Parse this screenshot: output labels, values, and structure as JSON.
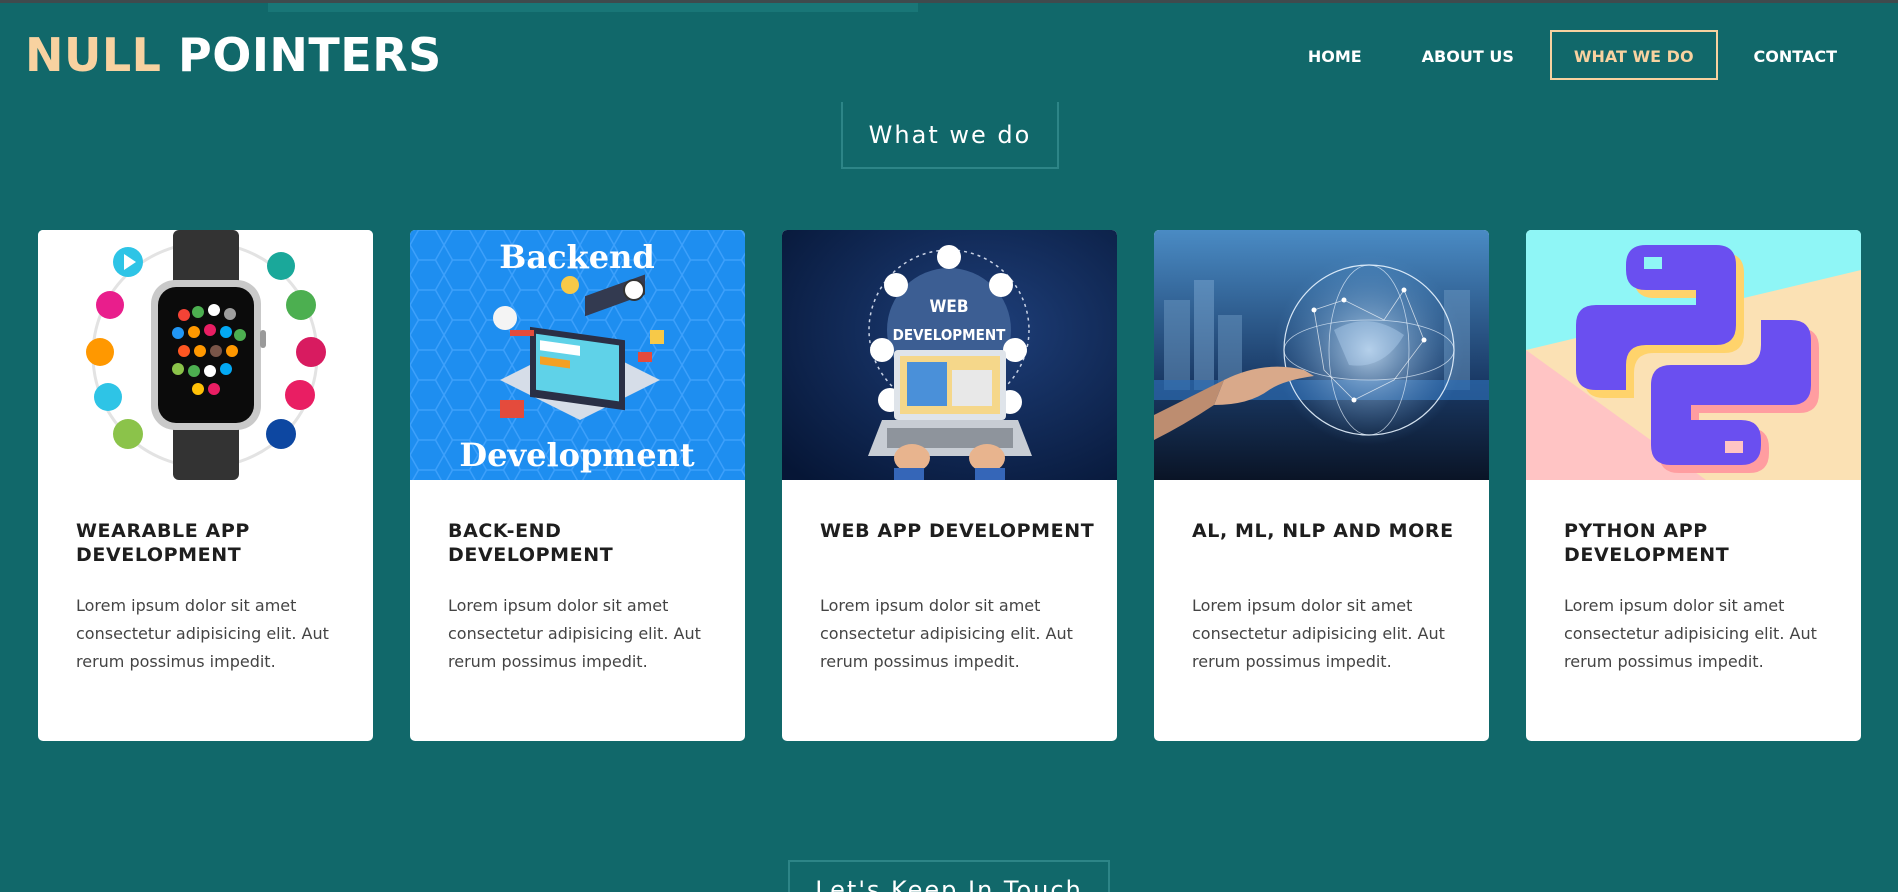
{
  "header": {
    "logo_accent": "NULL",
    "logo_main": "POINTERS",
    "nav": [
      {
        "label": "HOME"
      },
      {
        "label": "ABOUT US"
      },
      {
        "label": "WHAT WE DO"
      },
      {
        "label": "CONTACT"
      }
    ]
  },
  "section": {
    "title": "What we do"
  },
  "cards": [
    {
      "title": "WEARABLE APP DEVELOPMENT",
      "text": "Lorem ipsum dolor sit amet consectetur adipisicing elit. Aut rerum possimus impedit."
    },
    {
      "title": "BACK-END DEVELOPMENT",
      "text": "Lorem ipsum dolor sit amet consectetur adipisicing elit. Aut rerum possimus impedit.",
      "image_caption_top": "Backend",
      "image_caption_bottom": "Development"
    },
    {
      "title": "WEB APP DEVELOPMENT",
      "text": "Lorem ipsum dolor sit amet consectetur adipisicing elit. Aut rerum possimus impedit.",
      "image_caption_top": "WEB",
      "image_caption_bottom": "DEVELOPMENT"
    },
    {
      "title": "AL, ML, NLP AND MORE",
      "text": "Lorem ipsum dolor sit amet consectetur adipisicing elit. Aut rerum possimus impedit."
    },
    {
      "title": "PYTHON APP DEVELOPMENT",
      "text": "Lorem ipsum dolor sit amet consectetur adipisicing elit. Aut rerum possimus impedit."
    }
  ],
  "next_section": {
    "title": "Let's Keep In Touch"
  },
  "colors": {
    "background": "#11686a",
    "accent": "#f8d2a0",
    "card": "#ffffff"
  }
}
